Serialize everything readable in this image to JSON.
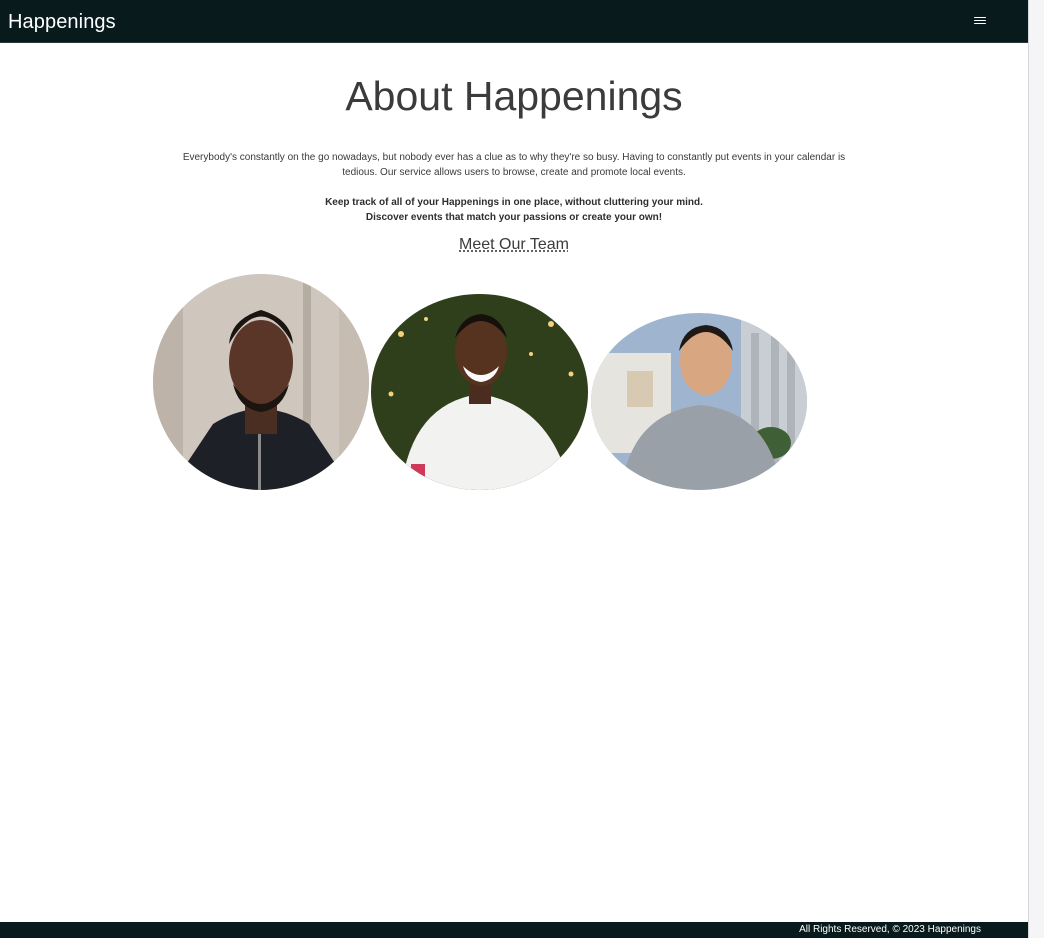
{
  "navbar": {
    "brand": "Happenings",
    "menu_icon": "hamburger-menu-icon"
  },
  "about": {
    "title": "About Happenings",
    "intro": "Everybody's constantly on the go nowadays, but nobody ever has a clue as to why they're so busy. Having to constantly put events in your calendar is tedious. Our service allows users to browse, create and promote local events.",
    "tagline_line1": "Keep track of all of your Happenings in one place, without cluttering your mind.",
    "tagline_line2": "Discover events that match your passions or create your own!"
  },
  "team": {
    "heading": "Meet Our Team",
    "members": [
      {
        "photo": "team-member-1-photo"
      },
      {
        "photo": "team-member-2-photo"
      },
      {
        "photo": "team-member-3-photo"
      }
    ]
  },
  "footer": {
    "text": "All Rights Reserved, © 2023 Happenings"
  },
  "colors": {
    "navbar_bg": "#081a1c",
    "text": "#3b3b3b",
    "page_bg": "#ffffff"
  }
}
